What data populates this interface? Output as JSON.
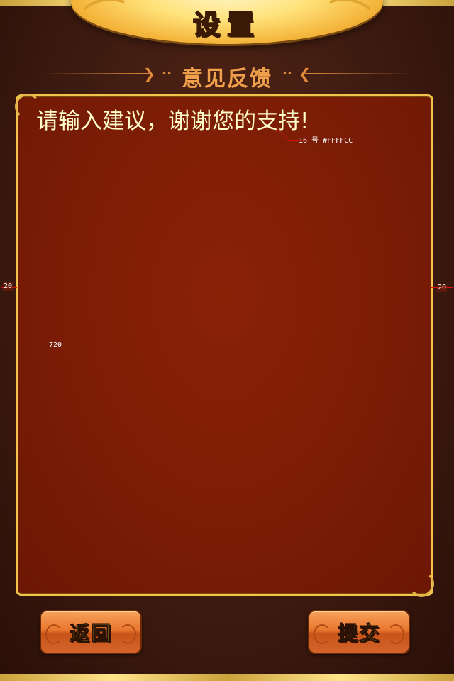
{
  "header": {
    "title": "设置"
  },
  "section": {
    "title": "意见反馈",
    "arrow_left": "❯",
    "arrow_right": "❮",
    "dots": "••"
  },
  "feedback": {
    "placeholder": "请输入建议，谢谢您的支持!",
    "value": "",
    "text_color": "#FFFFCC"
  },
  "annotations": {
    "font_spec": "16 号 #FFFFCC",
    "height_label": "720",
    "left_margin_label": "20",
    "right_margin_label": "20"
  },
  "buttons": {
    "back_label": "返回",
    "submit_label": "提交"
  },
  "colors": {
    "panel_background": "#7A1C05",
    "panel_border": "#F2C44A",
    "button_gradient_top": "#F8A25A",
    "button_text": "#FFE35A",
    "section_title": "#F0A04A"
  }
}
